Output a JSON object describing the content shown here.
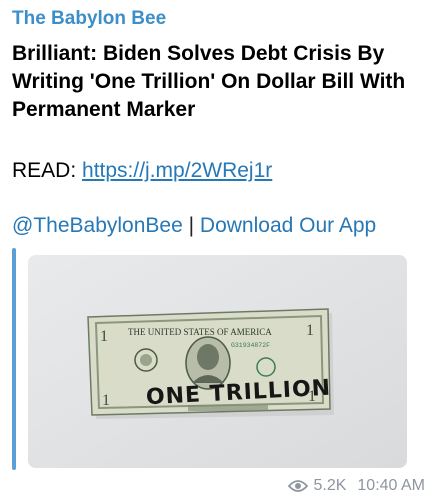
{
  "post": {
    "channel": "The Babylon Bee",
    "headline": "Brilliant: Biden Solves Debt Crisis By Writing 'One Trillion' On Dollar Bill With Permanent Marker",
    "read_label": "READ:",
    "read_url": "https://j.mp/2WRej1r",
    "handle": "@TheBabylonBee",
    "separator": "|",
    "app_link": "Download Our App"
  },
  "image": {
    "bill_header": "THE UNITED STATES OF AMERICA",
    "serial": "G31934872F",
    "marker_text": "ONE TRILLION",
    "numeral": "1"
  },
  "meta": {
    "views": "5.2K",
    "time": "10:40 AM"
  },
  "colors": {
    "link": "#2678b6",
    "channel": "#3d8ec9",
    "accent_bar": "#5aa0d6",
    "meta": "#8f96a0"
  }
}
